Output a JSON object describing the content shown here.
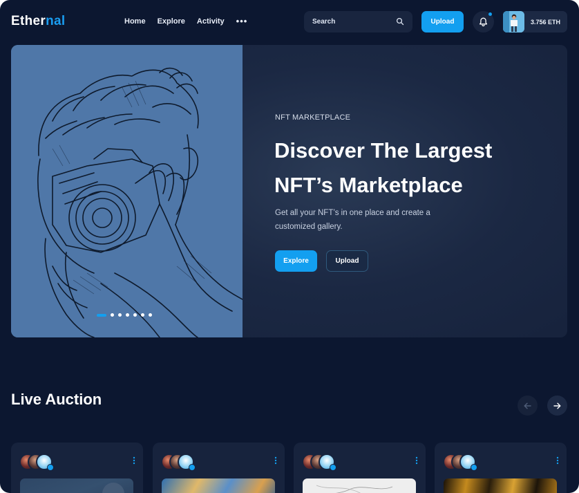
{
  "header": {
    "logo": {
      "part1": "Ether",
      "part2": "nal"
    },
    "nav": [
      "Home",
      "Explore",
      "Activity"
    ],
    "nav_more": "•••",
    "search": {
      "placeholder": "Search",
      "icon": "search-icon"
    },
    "upload_label": "Upload",
    "notifications": {
      "icon": "bell-icon",
      "has_unread": true
    },
    "wallet": {
      "balance": "3.756 ETH"
    }
  },
  "hero": {
    "eyebrow": "NFT MARKETPLACE",
    "title": "Discover The Largest NFT’s Marketplace",
    "description": "Get all your NFT’s in one place and create a customized gallery.",
    "explore_label": "Explore",
    "upload_label": "Upload",
    "slides_total": 7,
    "active_slide": 1
  },
  "live_auction": {
    "title": "Live Auction",
    "prev_icon": "arrow-left-icon",
    "next_icon": "arrow-right-icon",
    "cards": [
      {
        "image": "blue-abstract"
      },
      {
        "image": "blue-orange-paint"
      },
      {
        "image": "white-marble"
      },
      {
        "image": "gold-swirl"
      }
    ]
  },
  "colors": {
    "background": "#0c1730",
    "panel": "#17233d",
    "accent": "#139ff0"
  }
}
